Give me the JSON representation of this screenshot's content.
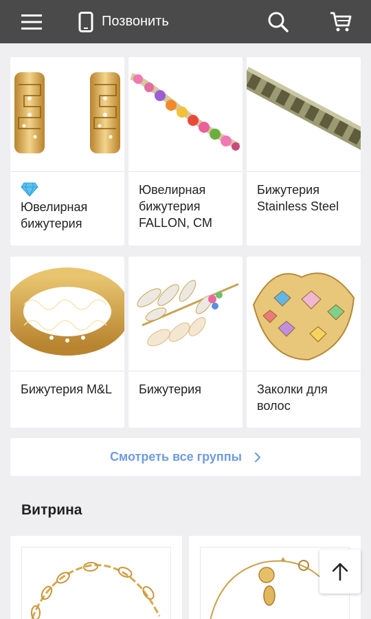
{
  "header": {
    "call_label": "Позвонить",
    "background": "#4a4a4a",
    "icons": [
      "menu-icon",
      "phone-icon",
      "search-icon",
      "cart-icon"
    ]
  },
  "categories": [
    {
      "title": "Ювелирная бижутерия",
      "badge_icon": "diamond-icon",
      "image": "gold-earrings"
    },
    {
      "title": "Ювелирная бижутерия FALLON, CM",
      "image": "multicolor-crystal-bracelet"
    },
    {
      "title": "Бижутерия Stainless Steel",
      "image": "steel-chain-bracelet"
    },
    {
      "title": "Бижутерия M&L",
      "image": "gold-filigree-bangle"
    },
    {
      "title": "Бижутерия",
      "image": "leaf-brooch"
    },
    {
      "title": "Заколки для волос",
      "image": "crystal-hair-clip"
    }
  ],
  "see_all": {
    "label": "Смотреть все группы",
    "color": "#6f9be2"
  },
  "showcase": {
    "title": "Витрина",
    "items": [
      {
        "image": "gold-link-bracelet"
      },
      {
        "image": "gold-charm-bracelet"
      }
    ]
  },
  "scroll_top_icon": "arrow-up-icon"
}
